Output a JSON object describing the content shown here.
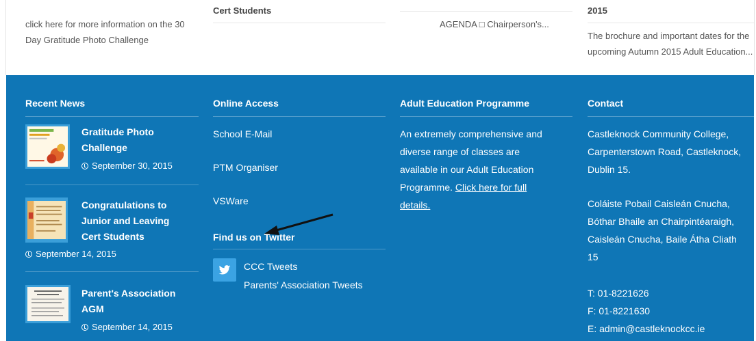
{
  "top": {
    "col1_text": [
      "click here for more information on the 30",
      "Day Gratitude Photo Challenge"
    ],
    "col2_cut_title": "Cert Students",
    "col3_text": "AGENDA □ Chairperson's...",
    "col4_cut_title": "2015",
    "col4_text": [
      "The brochure and important dates for the",
      "upcoming Autumn 2015 Adult Education..."
    ]
  },
  "recent_news": {
    "heading": "Recent News",
    "items": [
      {
        "title": [
          "Gratitude Photo",
          "Challenge"
        ],
        "date": "September 30, 2015"
      },
      {
        "title": [
          "Congratulations to",
          "Junior and Leaving",
          "Cert Students"
        ],
        "date": "September 14, 2015"
      },
      {
        "title": [
          "Parent's Association",
          "AGM"
        ],
        "date": "September 14, 2015"
      }
    ]
  },
  "online_access": {
    "heading": "Online Access",
    "links": [
      "School E-Mail",
      "PTM Organiser",
      "VSWare"
    ],
    "twitter_heading": "Find us on Twitter",
    "twitter_links": [
      "CCC Tweets",
      "Parents' Association Tweets"
    ]
  },
  "adult_education": {
    "heading": "Adult Education Programme",
    "body": [
      "An extremely comprehensive and",
      "diverse range of classes are",
      "available in our Adult Education",
      "Programme. "
    ],
    "link_part1": "Click here for full",
    "link_part2": "details."
  },
  "contact": {
    "heading": "Contact",
    "address_en": [
      "Castleknock Community College,",
      "Carpenterstown Road, Castleknock,",
      "Dublin 15."
    ],
    "address_ga": [
      "Coláiste Pobail Caisleán Cnucha,",
      "Bóthar Bhaile an Chairpintéaraigh,",
      "Caisleán Cnucha, Baile Átha Cliath",
      "15"
    ],
    "phone": "T: 01-8221626",
    "fax": "F: 01-8221630",
    "email": "E: admin@castleknockcc.ie"
  },
  "colors": {
    "footer_bg": "#0f76b6",
    "thumb_border": "#3b9fd9",
    "twitter": "#3ba3e3"
  }
}
